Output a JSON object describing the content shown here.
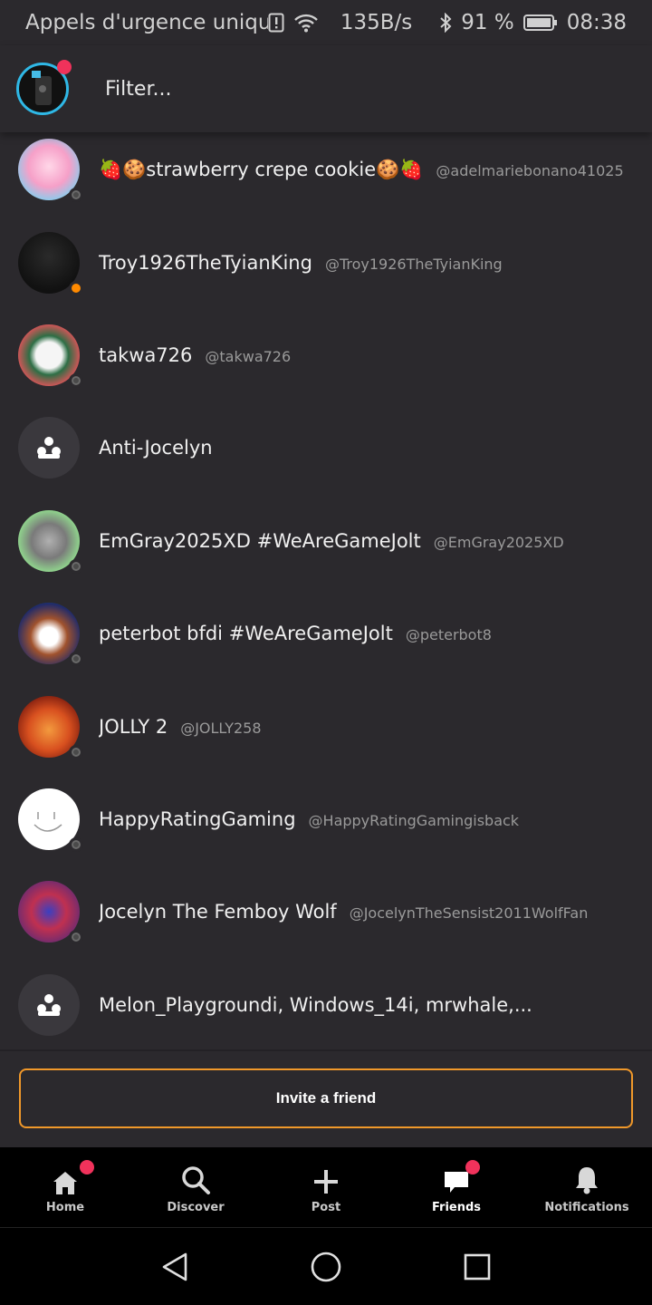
{
  "status_bar": {
    "carrier": "Appels d'urgence unique...",
    "speed": "135B/s",
    "battery": "91 %",
    "time": "08:38",
    "icons": [
      "sim-alert-icon",
      "wifi-icon",
      "bluetooth-icon",
      "battery-icon"
    ]
  },
  "header": {
    "filter_placeholder": "Filter..."
  },
  "friends": [
    {
      "display_name": "🍓🍪strawberry crepe cookie🍪🍓",
      "username": "@adelmariebonano41025",
      "avatar_color": "#f6a0c8",
      "status": "offline"
    },
    {
      "display_name": "Troy1926TheTyianKing",
      "username": "@Troy1926TheTyianKing",
      "avatar_color": "#151515",
      "status": "away"
    },
    {
      "display_name": "takwa726",
      "username": "@takwa726",
      "avatar_color": "#e9525a",
      "status": "offline"
    },
    {
      "display_name": "Anti-Jocelyn",
      "username": "",
      "avatar_color": "group",
      "status": "none"
    },
    {
      "display_name": "EmGray2025XD #WeAreGameJolt",
      "username": "@EmGray2025XD",
      "avatar_color": "#8fd18c",
      "status": "offline"
    },
    {
      "display_name": "peterbot bfdi #WeAreGameJolt",
      "username": "@peterbot8",
      "avatar_color": "#1e2a6a",
      "status": "offline"
    },
    {
      "display_name": "JOLLY 2",
      "username": "@JOLLY258",
      "avatar_color": "#c0391c",
      "status": "offline"
    },
    {
      "display_name": "HappyRatingGaming",
      "username": "@HappyRatingGamingisback",
      "avatar_color": "#ffffff",
      "status": "offline"
    },
    {
      "display_name": "Jocelyn The Femboy Wolf",
      "username": "@JocelynTheSensist2011WolfFan",
      "avatar_color": "#7a2c6b",
      "status": "offline"
    },
    {
      "display_name": "Melon_Playgroundi, Windows_14i, mrwhale,...",
      "username": "",
      "avatar_color": "group",
      "status": "none"
    }
  ],
  "invite_label": "Invite a friend",
  "tabs": [
    {
      "label": "Home",
      "icon": "home-icon",
      "badge": true
    },
    {
      "label": "Discover",
      "icon": "search-icon",
      "badge": false
    },
    {
      "label": "Post",
      "icon": "plus-icon",
      "badge": false
    },
    {
      "label": "Friends",
      "icon": "chat-icon",
      "badge": true,
      "active": true
    },
    {
      "label": "Notifications",
      "icon": "bell-icon",
      "badge": false
    }
  ],
  "colors": {
    "accent_orange": "#f0982a",
    "badge_pink": "#f0325b",
    "background": "#2b292d"
  }
}
